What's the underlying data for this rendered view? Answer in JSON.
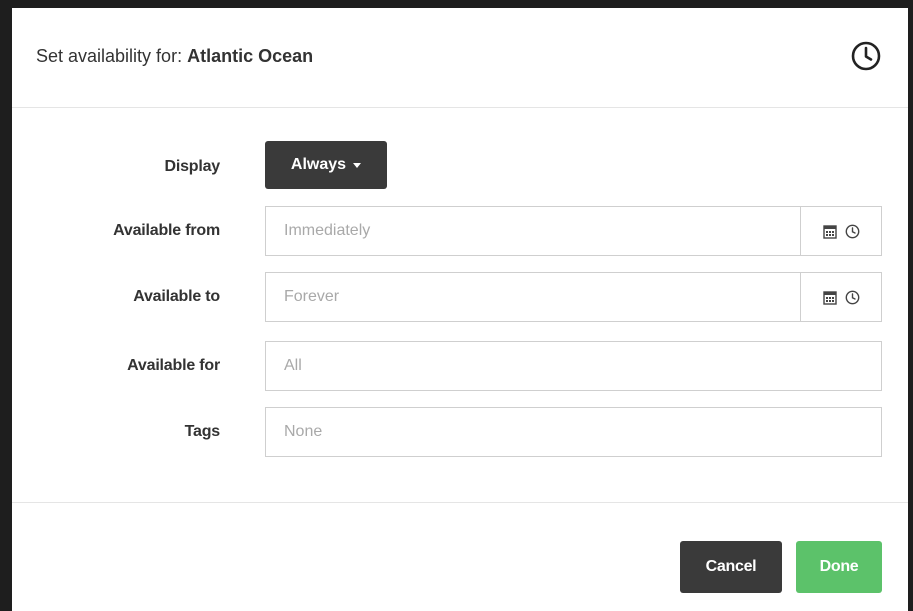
{
  "modal": {
    "title_prefix": "Set availability for: ",
    "title_subject": "Atlantic Ocean",
    "header_icon": "clock-icon"
  },
  "form": {
    "display": {
      "label": "Display",
      "value": "Always"
    },
    "available_from": {
      "label": "Available from",
      "placeholder": "Immediately",
      "icons": [
        "calendar-icon",
        "clock-icon"
      ]
    },
    "available_to": {
      "label": "Available to",
      "placeholder": "Forever",
      "icons": [
        "calendar-icon",
        "clock-icon"
      ]
    },
    "available_for": {
      "label": "Available for",
      "placeholder": "All"
    },
    "tags": {
      "label": "Tags",
      "placeholder": "None"
    }
  },
  "footer": {
    "cancel_label": "Cancel",
    "done_label": "Done"
  },
  "colors": {
    "dark_button": "#3a3a3a",
    "done_button": "#5cc26a",
    "border": "#cfcfcf",
    "text": "#333333",
    "placeholder": "#a9a9a9"
  }
}
